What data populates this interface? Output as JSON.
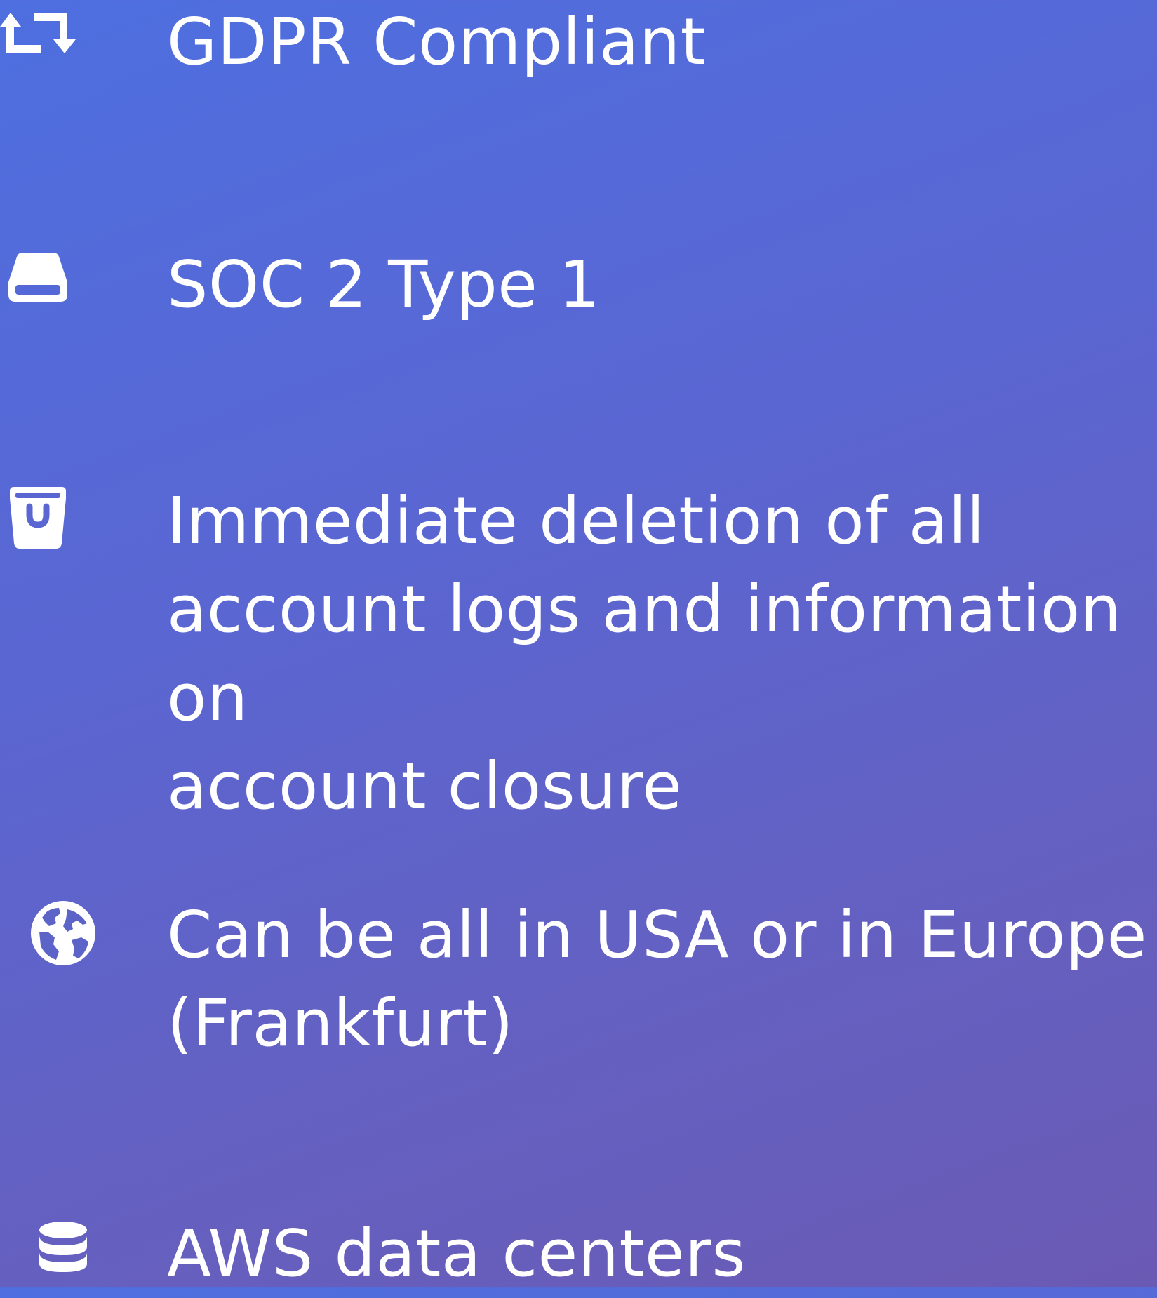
{
  "features": [
    {
      "icon": "retweet-icon",
      "text": "GDPR Compliant"
    },
    {
      "icon": "hard-drive-icon",
      "text": "SOC 2 Type 1"
    },
    {
      "icon": "shopping-bag-icon",
      "text": "Immediate deletion of all\naccount logs and information on\naccount closure"
    },
    {
      "icon": "globe-icon",
      "text": "Can be all in USA or in Europe\n(Frankfurt)"
    },
    {
      "icon": "database-icon",
      "text": "AWS data centers"
    }
  ],
  "colors": {
    "gradient_start": "#4e6fe0",
    "gradient_end": "#6a5ab4",
    "text": "#ffffff"
  }
}
